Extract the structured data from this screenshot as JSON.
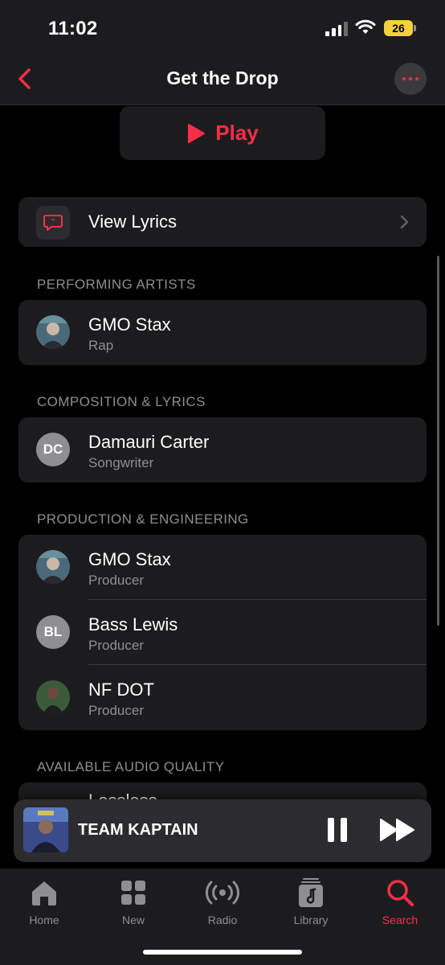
{
  "status": {
    "time": "11:02",
    "battery": "26"
  },
  "header": {
    "title": "Get the Drop"
  },
  "play": {
    "label": "Play"
  },
  "lyrics": {
    "label": "View Lyrics"
  },
  "sections": {
    "performing": {
      "title": "PERFORMING ARTISTS",
      "items": [
        {
          "name": "GMO Stax",
          "role": "Rap"
        }
      ]
    },
    "composition": {
      "title": "COMPOSITION & LYRICS",
      "items": [
        {
          "name": "Damauri Carter",
          "role": "Songwriter",
          "initials": "DC"
        }
      ]
    },
    "production": {
      "title": "PRODUCTION & ENGINEERING",
      "items": [
        {
          "name": "GMO Stax",
          "role": "Producer"
        },
        {
          "name": "Bass Lewis",
          "role": "Producer",
          "initials": "BL"
        },
        {
          "name": "NF DOT",
          "role": "Producer"
        }
      ]
    },
    "quality": {
      "title": "AVAILABLE AUDIO QUALITY",
      "peek": "Lossless"
    }
  },
  "player": {
    "title": "TEAM KAPTAIN"
  },
  "tabs": [
    {
      "label": "Home",
      "icon": "home-icon"
    },
    {
      "label": "New",
      "icon": "grid-icon"
    },
    {
      "label": "Radio",
      "icon": "radio-icon"
    },
    {
      "label": "Library",
      "icon": "library-icon"
    },
    {
      "label": "Search",
      "icon": "search-icon",
      "active": true
    }
  ],
  "colors": {
    "accent": "#fa2d48",
    "card": "#1c1c1e",
    "secondary_text": "#8e8e93"
  }
}
